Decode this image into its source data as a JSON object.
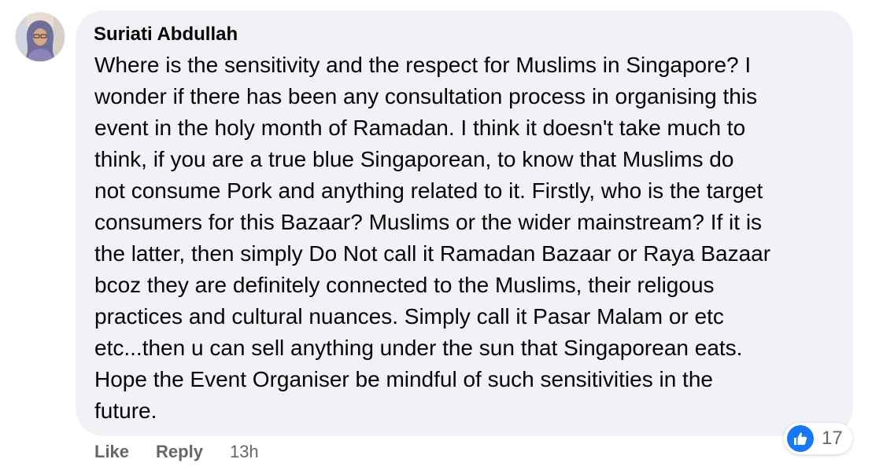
{
  "comment": {
    "author": "Suriati Abdullah",
    "body_lines": [
      "Where is the sensitivity and the respect for Muslims in Singapore? I",
      "wonder if there has been any consultation process in organising this",
      "event in the holy month of Ramadan. I think it doesn't take much to",
      "think, if you are a true blue Singaporean, to know that Muslims do",
      "not consume Pork and anything related to it. Firstly, who is the target",
      "consumers for this Bazaar? Muslims or the wider mainstream? If it is",
      "the latter, then simply Do Not call it Ramadan Bazaar or Raya Bazaar",
      "bcoz they are definitely connected to the Muslims, their religous",
      "practices and cultural nuances. Simply call it Pasar Malam or etc",
      "etc...then u can sell anything under the sun that Singaporean eats.",
      "Hope the Event Organiser be mindful of such sensitivities in the",
      "future."
    ],
    "reactions": {
      "icon": "thumbs-up-icon",
      "count": "17",
      "color": "#1877f2"
    },
    "actions": {
      "like_label": "Like",
      "reply_label": "Reply",
      "timestamp": "13h"
    }
  },
  "colors": {
    "bubble_bg": "#f0f2f5",
    "text": "#050505",
    "secondary_text": "#65676b",
    "like_blue": "#1877f2"
  }
}
